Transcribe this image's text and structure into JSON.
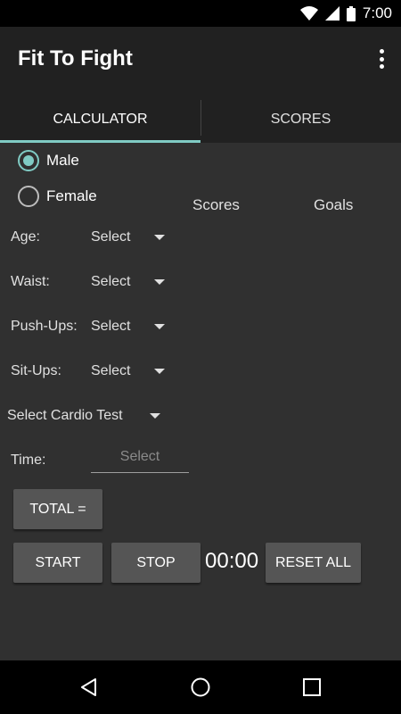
{
  "status_bar": {
    "time": "7:00",
    "icons": [
      "wifi-icon",
      "signal-icon",
      "battery-icon"
    ]
  },
  "app_bar": {
    "title": "Fit To Fight",
    "overflow_icon": "more-vert-icon"
  },
  "tabs": [
    {
      "label": "CALCULATOR",
      "selected": true
    },
    {
      "label": "SCORES",
      "selected": false
    }
  ],
  "gender": {
    "options": [
      {
        "label": "Male",
        "checked": true
      },
      {
        "label": "Female",
        "checked": false
      }
    ]
  },
  "columns": {
    "scores": "Scores",
    "goals": "Goals"
  },
  "fields": {
    "age": {
      "label": "Age:",
      "value": "Select"
    },
    "waist": {
      "label": "Waist:",
      "value": "Select"
    },
    "pushups": {
      "label": "Push-Ups:",
      "value": "Select"
    },
    "situps": {
      "label": "Sit-Ups:",
      "value": "Select"
    },
    "cardio": {
      "value": "Select Cardio Test"
    },
    "time": {
      "label": "Time:",
      "placeholder": "Select"
    }
  },
  "buttons": {
    "total": "TOTAL =",
    "start": "START",
    "stop": "STOP",
    "reset": "RESET ALL"
  },
  "timer": "00:00",
  "colors": {
    "accent": "#80cbc4",
    "background": "#303030",
    "appbar": "#212121",
    "button": "#555555"
  },
  "nav_bar": {
    "icons": [
      "back-icon",
      "home-icon",
      "recents-icon"
    ]
  }
}
